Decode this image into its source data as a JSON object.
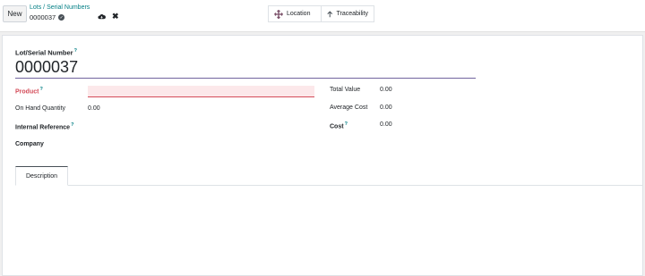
{
  "control_panel": {
    "new_label": "New",
    "breadcrumb": "Lots / Serial Numbers",
    "record_name": "0000037"
  },
  "smart_buttons": {
    "location": "Location",
    "traceability": "Traceability"
  },
  "form": {
    "lot_label": "Lot/Serial Number",
    "lot_value": "0000037",
    "tooltip_mark": "?",
    "product_label": "Product",
    "on_hand_label": "On Hand Quantity",
    "on_hand_value": "0.00",
    "internal_ref_label": "Internal Reference",
    "company_label": "Company",
    "total_value_label": "Total Value",
    "total_value": "0.00",
    "avg_cost_label": "Average Cost",
    "avg_cost_value": "0.00",
    "cost_label": "Cost",
    "cost_value": "0.00"
  },
  "notebook": {
    "tabs": [
      {
        "label": "Description"
      }
    ]
  },
  "colors": {
    "accent": "#017e84",
    "required": "#d44c59",
    "input_underline": "#71639e"
  }
}
